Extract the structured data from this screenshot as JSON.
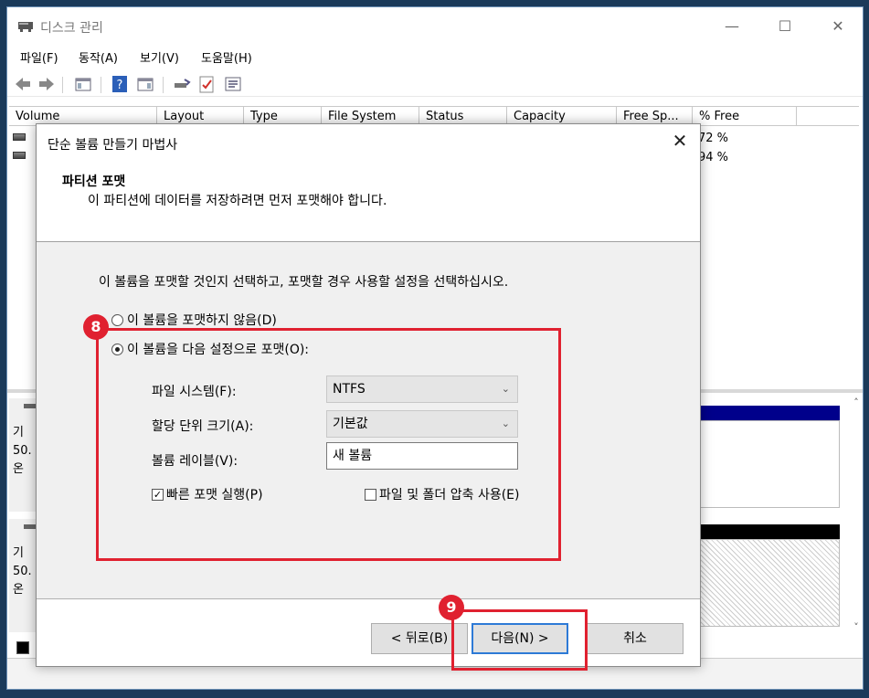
{
  "window": {
    "title": "디스크 관리",
    "minimize": "—",
    "maximize": "☐",
    "close": "✕"
  },
  "menu": [
    "파일(F)",
    "동작(A)",
    "보기(V)",
    "도움말(H)"
  ],
  "columns": [
    "Volume",
    "Layout",
    "Type",
    "File System",
    "Status",
    "Capacity",
    "Free Sp...",
    "% Free"
  ],
  "volumes": [
    {
      "pct_free": "72 %"
    },
    {
      "pct_free": "94 %"
    }
  ],
  "disks": [
    {
      "line1": "기",
      "line2": "50.",
      "line3": "온"
    },
    {
      "line1": "기",
      "line2": "50.",
      "line3": "온"
    }
  ],
  "dialog": {
    "title": "단순 볼륨 만들기 마법사",
    "close": "✕",
    "heading": "파티션 포맷",
    "subheading": "이 파티션에 데이터를 저장하려면 먼저 포맷해야 합니다.",
    "instruction": "이 볼륨을 포맷할 것인지 선택하고, 포맷할 경우 사용할 설정을 선택하십시오.",
    "radio_no_format": "이 볼륨을 포맷하지 않음(D)",
    "radio_format": "이 볼륨을 다음 설정으로 포맷(O):",
    "fs_label": "파일 시스템(F):",
    "fs_value": "NTFS",
    "alloc_label": "할당 단위 크기(A):",
    "alloc_value": "기본값",
    "vol_label_label": "볼륨 레이블(V):",
    "vol_label_value": "새 볼륨",
    "quick_format": "빠른 포맷 실행(P)",
    "compression": "파일 및 폴더 압축 사용(E)",
    "back_button": "< 뒤로(B)",
    "next_button": "다음(N) >",
    "cancel_button": "취소"
  },
  "annotations": {
    "step8": "8",
    "step9": "9",
    "color": "#e02130"
  }
}
